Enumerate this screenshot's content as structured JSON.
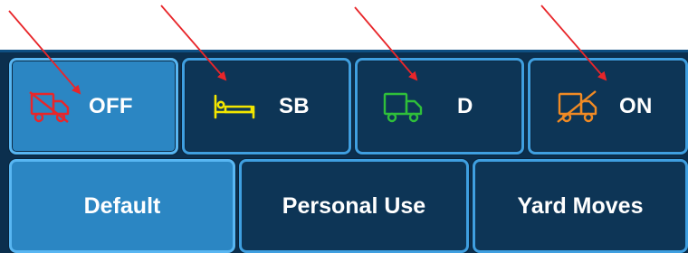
{
  "duty_status": {
    "buttons": [
      {
        "id": "off",
        "label": "OFF",
        "icon": "truck-off-icon",
        "icon_color": "#e8262a",
        "active": true
      },
      {
        "id": "sb",
        "label": "SB",
        "icon": "bed-icon",
        "icon_color": "#f2e600",
        "active": false
      },
      {
        "id": "d",
        "label": "D",
        "icon": "truck-icon",
        "icon_color": "#2fbf3a",
        "active": false
      },
      {
        "id": "on",
        "label": "ON",
        "icon": "truck-on-icon",
        "icon_color": "#f08a24",
        "active": false
      }
    ]
  },
  "modes": {
    "buttons": [
      {
        "id": "default",
        "label": "Default",
        "active": true
      },
      {
        "id": "personal_use",
        "label": "Personal Use",
        "active": false
      },
      {
        "id": "yard_moves",
        "label": "Yard Moves",
        "active": false
      }
    ]
  },
  "colors": {
    "panel_bg": "#0b2f4e",
    "button_bg": "#0d3556",
    "button_active_bg": "#2b86c3",
    "button_border": "#3f9fe0",
    "annotation_arrow": "#e8262a"
  }
}
